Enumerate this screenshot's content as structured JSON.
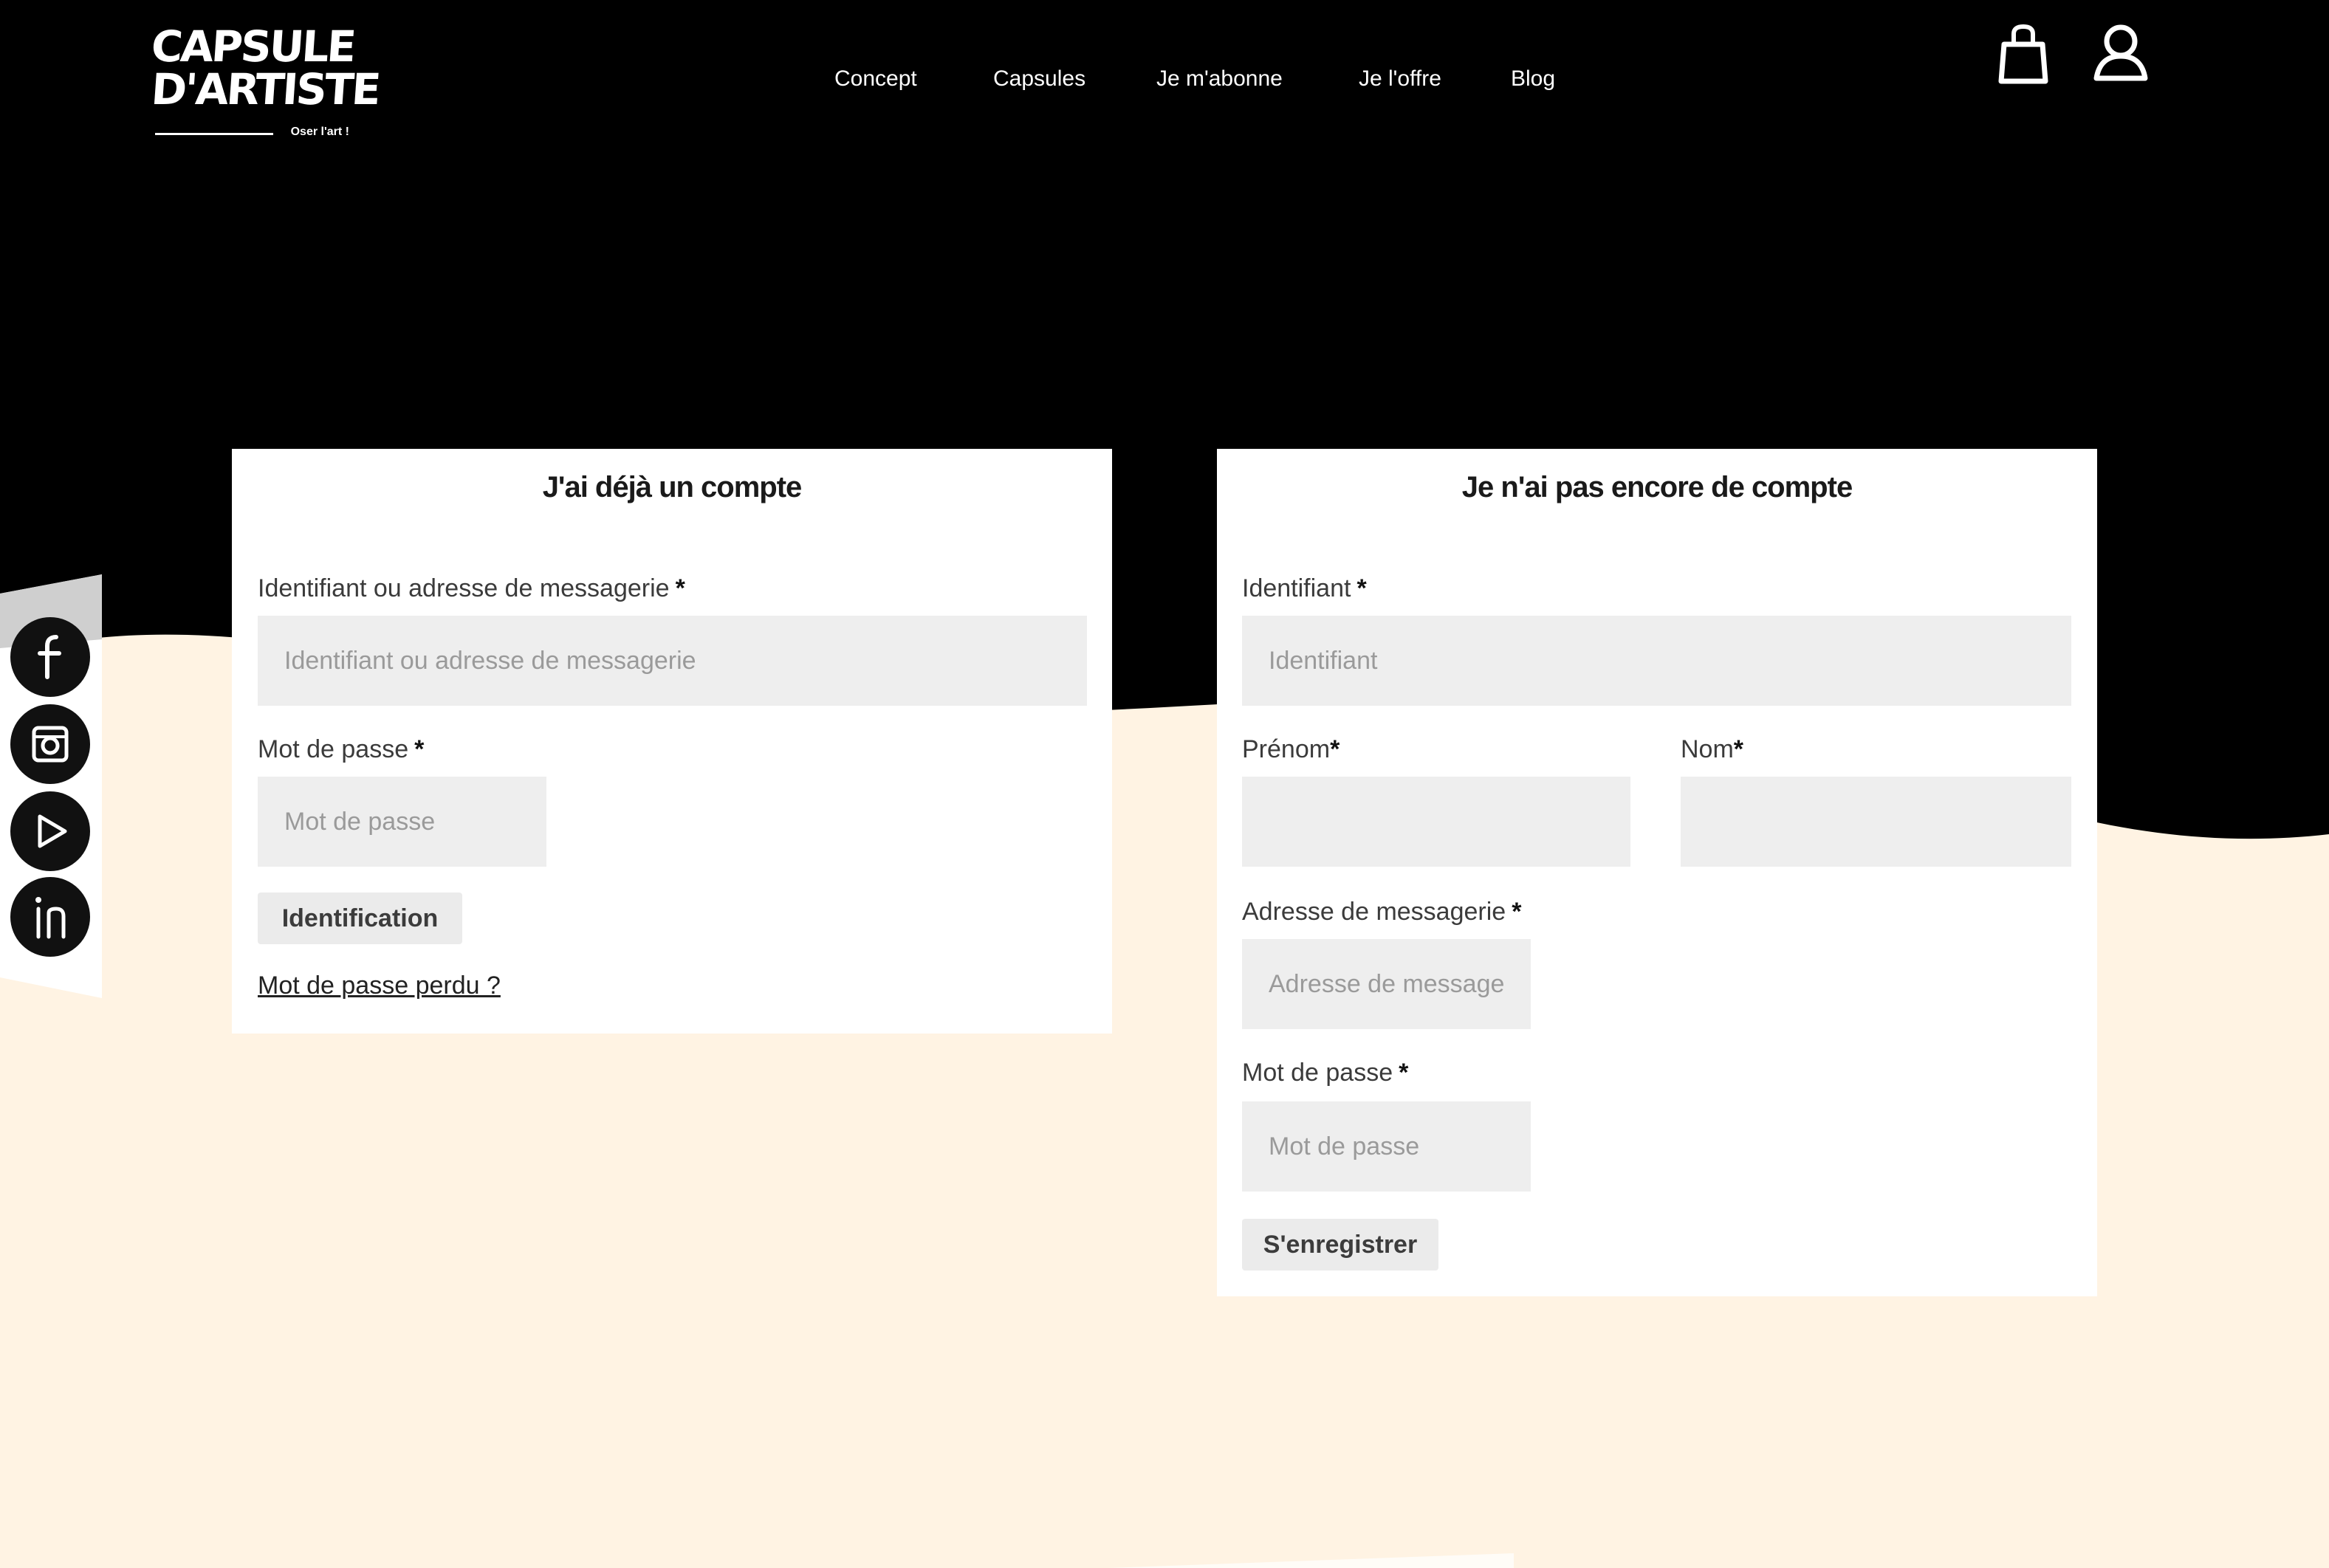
{
  "header": {
    "logo": {
      "line1": "CAPSULE",
      "line2": "D'ARTISTE",
      "tagline": "Oser l'art !"
    },
    "nav": [
      {
        "label": "Concept"
      },
      {
        "label": "Capsules"
      },
      {
        "label": "Je m'abonne"
      },
      {
        "label": "Je l'offre"
      },
      {
        "label": "Blog"
      }
    ],
    "icons": {
      "cart": "shopping-bag-icon",
      "account": "user-icon"
    }
  },
  "social": {
    "icons": [
      "facebook-icon",
      "instagram-icon",
      "youtube-icon",
      "linkedin-icon"
    ]
  },
  "login": {
    "title": "J'ai déjà un compte",
    "username_label": "Identifiant ou adresse de messagerie",
    "username_placeholder": "Identifiant ou adresse de messagerie",
    "password_label": "Mot de passe",
    "password_placeholder": "Mot de passe",
    "submit_label": "Identification",
    "lost_password": "Mot de passe perdu ?"
  },
  "register": {
    "title": "Je n'ai pas encore de compte",
    "username_label": "Identifiant",
    "username_placeholder": "Identifiant",
    "firstname_label": "Prénom",
    "lastname_label": "Nom",
    "email_label": "Adresse de messagerie",
    "email_placeholder": "Adresse de messagerie",
    "password_label": "Mot de passe",
    "password_placeholder": "Mot de passe",
    "submit_label": "S'enregistrer"
  },
  "required_marker": "*",
  "colors": {
    "header_bg": "#000000",
    "page_bg": "#fff3e3",
    "card_bg": "#ffffff",
    "input_bg": "#eeeeee",
    "button_bg": "#ebebeb"
  }
}
